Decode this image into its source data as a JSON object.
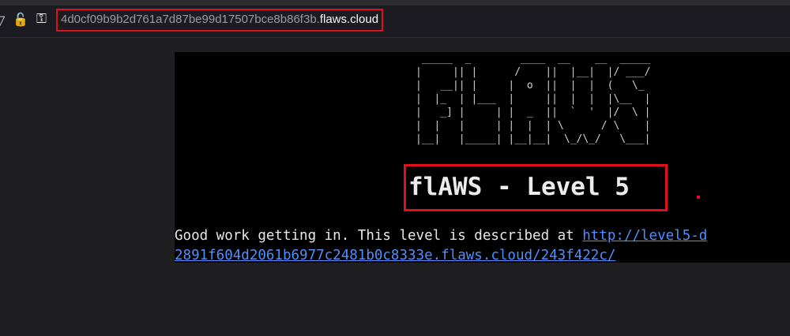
{
  "browser": {
    "url_prefix": "4d0cf09b9b2d761a7d87be99d17507bce8b86f3b.",
    "url_host": "flaws.cloud",
    "icons": [
      "lock-crossed-icon",
      "key-icon"
    ]
  },
  "page": {
    "banner_ascii": " _____  _        ____  __    __  _____\n|     || |      /    ||  |__|  |/ ___/\n|   __|| |     |  o  ||  |  |  (   \\_ \n|  |_  | |___  |     ||  |  |  |\\__  |\n|   _] |     | |  _  ||  `  '  |/  \\ |\n|  |   |     | |  |  | \\      / \\    |\n|__|   |_____| |__|__|  \\_/\\_/   \\___|",
    "title": "flAWS - Level 5",
    "intro": "Good work getting in. This level is described at ",
    "link": "http://level5-d2891f604d2061b6977c2481b0c8333e.flaws.cloud/243f422c/"
  },
  "annotation_color": "#e0101a"
}
